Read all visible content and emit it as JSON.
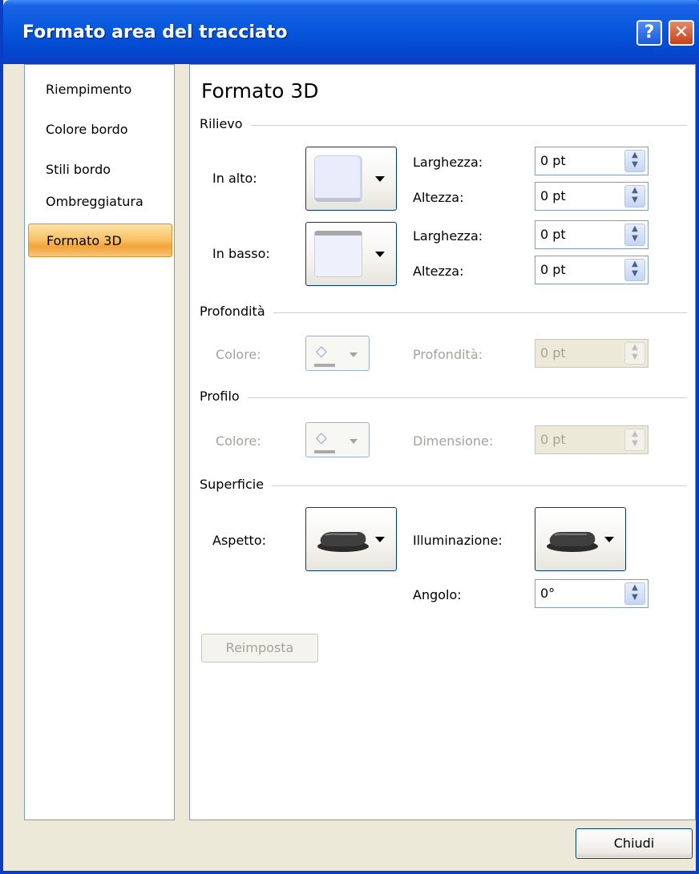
{
  "window": {
    "title": "Formato area del tracciato"
  },
  "titlebar": {
    "help_label": "?",
    "close_label": "✕"
  },
  "nav": {
    "items": [
      {
        "label": "Riempimento"
      },
      {
        "label": "Colore bordo"
      },
      {
        "label": "Stili bordo"
      },
      {
        "label": "Ombreggiatura"
      },
      {
        "label": "Formato 3D",
        "selected": true
      }
    ]
  },
  "main": {
    "heading": "Formato 3D",
    "rilievo": {
      "section_label": "Rilievo",
      "top_label": "In alto:",
      "bottom_label": "In basso:",
      "width_label": "Larghezza:",
      "height_label": "Altezza:",
      "top_width": "0 pt",
      "top_height": "0 pt",
      "bottom_width": "0 pt",
      "bottom_height": "0 pt"
    },
    "profondita": {
      "section_label": "Profondità",
      "color_label": "Colore:",
      "depth_label": "Profondità:",
      "depth_value": "0 pt"
    },
    "profilo": {
      "section_label": "Profilo",
      "color_label": "Colore:",
      "size_label": "Dimensione:",
      "size_value": "0 pt"
    },
    "superficie": {
      "section_label": "Superficie",
      "appearance_label": "Aspetto:",
      "lighting_label": "Illuminazione:",
      "angle_label": "Angolo:",
      "angle_value": "0°"
    },
    "reset_label": "Reimposta"
  },
  "footer": {
    "close_label": "Chiudi"
  },
  "colors": {
    "title_blue": "#0757dc",
    "selected_orange": "#f9c46b",
    "disabled_text": "#a3a39a"
  },
  "icons": [
    "help-icon",
    "close-icon",
    "bevel-top-icon",
    "bevel-bottom-icon",
    "paint-bucket-icon",
    "material-icon",
    "lighting-icon",
    "spin-arrows-icon",
    "dropdown-arrow-icon"
  ]
}
